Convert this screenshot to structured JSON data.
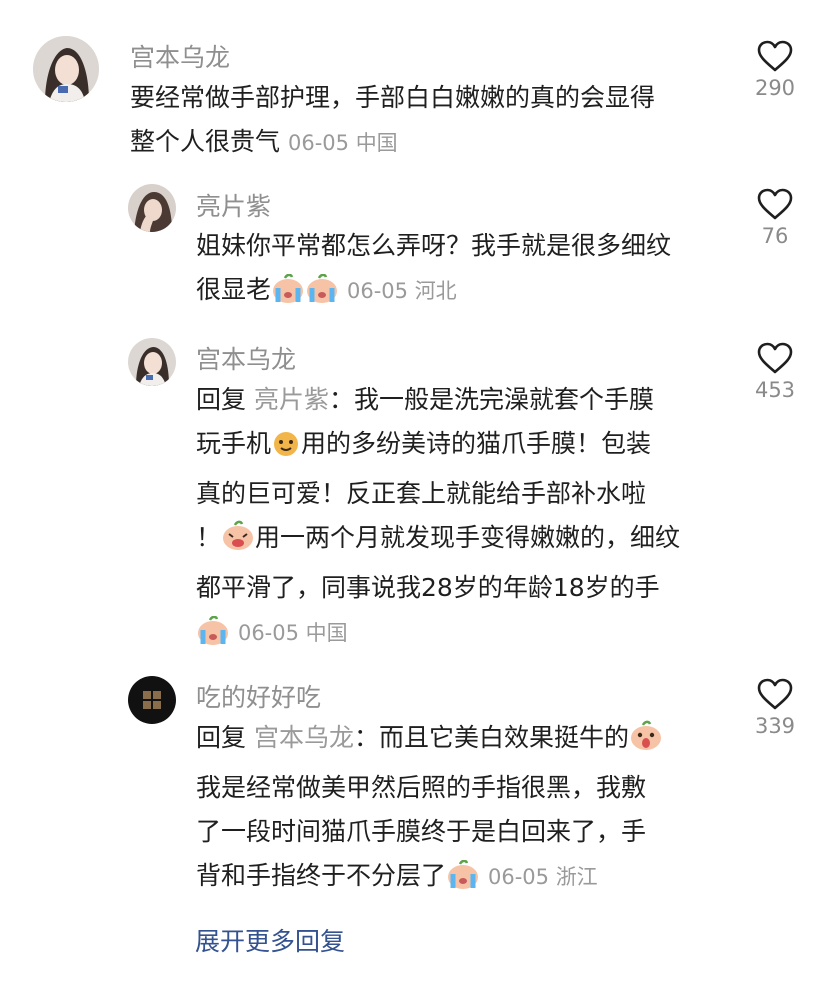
{
  "comments": [
    {
      "username": "宫本乌龙",
      "text_line1": "要经常做手部护理，手部白白嫩嫩的真的会显得",
      "text_line2": "整个人很贵气",
      "date": "06-05",
      "location": "中国",
      "likes": "290",
      "avatar_icon": "woman-portrait-avatar"
    },
    {
      "username": "亮片紫",
      "text_line1": "姐妹你平常都怎么弄呀？我手就是很多细纹",
      "text_line2": "很显老",
      "date": "06-05",
      "location": "河北",
      "likes": "76",
      "avatar_icon": "hand-on-face-avatar"
    },
    {
      "username": "宫本乌龙",
      "reply_prefix": "回复",
      "reply_to": "亮片紫",
      "reply_colon": "：",
      "text_line1": "我一般是洗完澡就套个手膜",
      "text_line2a": "玩手机",
      "text_line2b": "用的多纷美诗的猫爪手膜！包装",
      "text_line3": "真的巨可爱！反正套上就能给手部补水啦",
      "text_line4a": "！",
      "text_line4b": "用一两个月就发现手变得嫩嫩的，细纹",
      "text_line5": "都平滑了，同事说我28岁的年龄18岁的手",
      "date": "06-05",
      "location": "中国",
      "likes": "453",
      "avatar_icon": "woman-portrait-avatar"
    },
    {
      "username": "吃的好好吃",
      "reply_prefix": "回复",
      "reply_to": "宫本乌龙",
      "reply_colon": "：",
      "text_line1": "而且它美白效果挺牛的",
      "text_line2": "我是经常做美甲然后照的手指很黑，我敷",
      "text_line3": "了一段时间猫爪手膜终于是白回来了，手",
      "text_line4": "背和手指终于不分层了",
      "date": "06-05",
      "location": "浙江",
      "likes": "339",
      "avatar_icon": "dark-grid-avatar"
    }
  ],
  "expand_replies": "展开更多回复",
  "colors": {
    "text": "#1f1f1f",
    "muted": "#8f8f8f",
    "link": "#34528f"
  }
}
